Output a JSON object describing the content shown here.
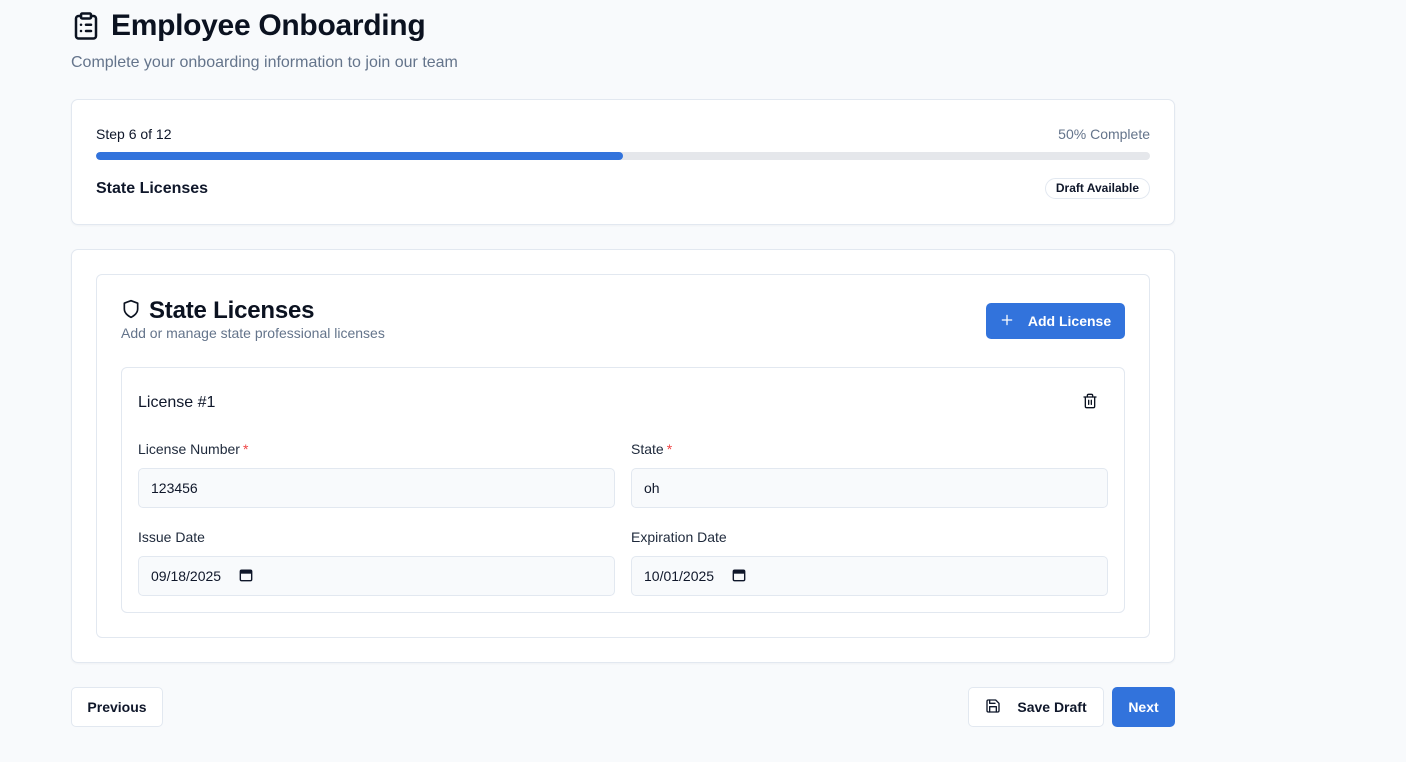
{
  "header": {
    "icon": "clipboard-list-icon",
    "title": "Employee Onboarding",
    "subtitle": "Complete your onboarding information to join our team"
  },
  "progress": {
    "step_text": "Step 6 of 12",
    "percent_text": "50% Complete",
    "fill_fraction": 0.5,
    "section_name": "State Licenses",
    "badge": "Draft Available"
  },
  "section": {
    "icon": "shield-icon",
    "title": "State Licenses",
    "description": "Add or manage state professional licenses",
    "add_button_label": "Add License"
  },
  "license": {
    "title": "License #1",
    "fields": {
      "license_number": {
        "label": "License Number",
        "required_mark": "*",
        "value": "123456"
      },
      "state": {
        "label": "State",
        "required_mark": "*",
        "value": "oh"
      },
      "issue_date": {
        "label": "Issue Date",
        "value": "09/18/2025"
      },
      "expiration_date": {
        "label": "Expiration Date",
        "value": "10/01/2025"
      }
    }
  },
  "footer": {
    "previous_label": "Previous",
    "save_draft_label": "Save Draft",
    "next_label": "Next"
  },
  "colors": {
    "accent": "#3273dc",
    "background": "#f8fafc",
    "border": "#e2e8f0",
    "muted_text": "#64748b",
    "required": "#ef4444"
  }
}
